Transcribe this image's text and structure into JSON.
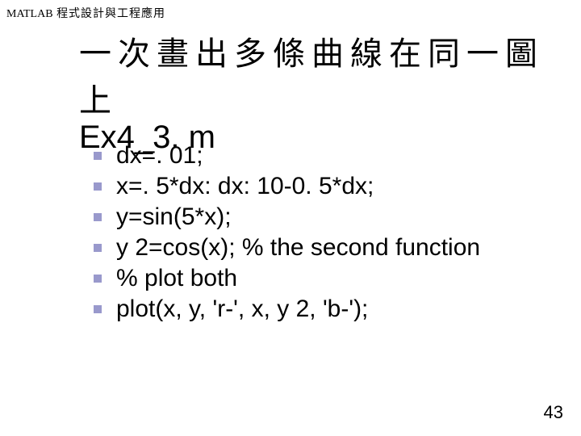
{
  "header": {
    "brand": "MATLAB",
    "subtitle": "程式設計與工程應用"
  },
  "title": {
    "zh": "一次畫出多條曲線在同一圖上",
    "en": "Ex4_3. m"
  },
  "code_lines": {
    "l1": "dx=. 01;",
    "l2": "x=. 5*dx: dx: 10-0. 5*dx;",
    "l3": "y=sin(5*x);",
    "l4": "y 2=cos(x); % the second function",
    "l5": "% plot both",
    "l6": "plot(x, y, 'r-', x, y 2, 'b-');"
  },
  "page_number": "43"
}
